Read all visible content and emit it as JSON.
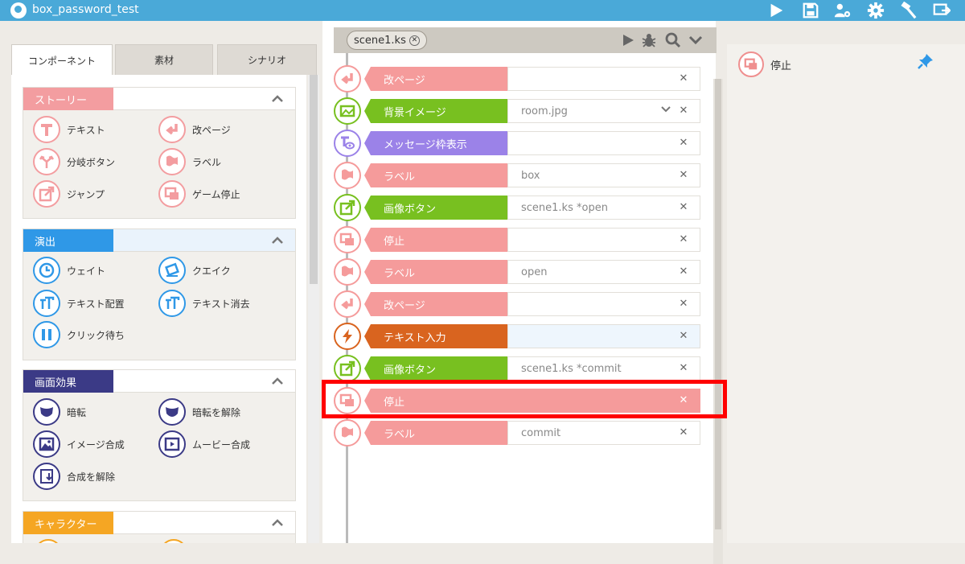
{
  "app": {
    "title": "box_password_test"
  },
  "titlebar_icons": [
    "play-icon",
    "save-icon",
    "users-gear-icon",
    "gear-icon",
    "hammer-icon",
    "export-icon"
  ],
  "tabs": [
    {
      "label": "コンポーネント",
      "active": true
    },
    {
      "label": "素材",
      "active": false
    },
    {
      "label": "シナリオ",
      "active": false
    }
  ],
  "sections": [
    {
      "title": "ストーリー",
      "color": "#f39da0",
      "items": [
        {
          "label": "テキスト",
          "icon": "text-t-icon"
        },
        {
          "label": "改ページ",
          "icon": "page-break-icon"
        },
        {
          "label": "分岐ボタン",
          "icon": "branch-icon"
        },
        {
          "label": "ラベル",
          "icon": "flag-icon"
        },
        {
          "label": "ジャンプ",
          "icon": "jump-icon"
        },
        {
          "label": "ゲーム停止",
          "icon": "stop-window-icon"
        }
      ]
    },
    {
      "title": "演出",
      "color": "#2f98e7",
      "items": [
        {
          "label": "ウェイト",
          "icon": "clock-icon"
        },
        {
          "label": "クエイク",
          "icon": "quake-icon"
        },
        {
          "label": "テキスト配置",
          "icon": "text-place-icon"
        },
        {
          "label": "テキスト消去",
          "icon": "text-erase-icon"
        },
        {
          "label": "クリック待ち",
          "icon": "click-wait-icon"
        }
      ]
    },
    {
      "title": "画面効果",
      "color": "#3b3a86",
      "items": [
        {
          "label": "暗転",
          "icon": "fade-dark-icon"
        },
        {
          "label": "暗転を解除",
          "icon": "fade-release-icon"
        },
        {
          "label": "イメージ合成",
          "icon": "image-compose-icon"
        },
        {
          "label": "ムービー合成",
          "icon": "movie-compose-icon"
        },
        {
          "label": "合成を解除",
          "icon": "compose-release-icon"
        }
      ]
    },
    {
      "title": "キャラクター",
      "color": "#f5a623",
      "items": []
    }
  ],
  "editor": {
    "file_tab": "scene1.ks",
    "rows": [
      {
        "label": "改ページ",
        "value": "",
        "color": "#f59b9b",
        "icon": "page-break-icon",
        "has_dropdown": false
      },
      {
        "label": "背景イメージ",
        "value": "room.jpg",
        "color": "#78c020",
        "icon": "background-image-icon",
        "has_dropdown": true
      },
      {
        "label": "メッセージ枠表示",
        "value": "",
        "color": "#9b82e8",
        "icon": "message-window-icon",
        "has_dropdown": false
      },
      {
        "label": "ラベル",
        "value": "box",
        "color": "#f59b9b",
        "icon": "flag-icon",
        "has_dropdown": false
      },
      {
        "label": "画像ボタン",
        "value": "scene1.ks *open",
        "color": "#78c020",
        "icon": "image-button-icon",
        "has_dropdown": false
      },
      {
        "label": "停止",
        "value": "",
        "color": "#f59b9b",
        "icon": "stop-window-icon",
        "has_dropdown": false
      },
      {
        "label": "ラベル",
        "value": "open",
        "color": "#f59b9b",
        "icon": "flag-icon",
        "has_dropdown": false
      },
      {
        "label": "改ページ",
        "value": "",
        "color": "#f59b9b",
        "icon": "page-break-icon",
        "has_dropdown": false
      },
      {
        "label": "テキスト入力",
        "value": "",
        "color": "#d9641f",
        "icon": "lightning-icon",
        "has_dropdown": false
      },
      {
        "label": "画像ボタン",
        "value": "scene1.ks *commit",
        "color": "#78c020",
        "icon": "image-button-icon",
        "has_dropdown": false
      },
      {
        "label": "停止",
        "value": "",
        "color": "#f59b9b",
        "icon": "stop-window-icon",
        "has_dropdown": false,
        "selected": true
      },
      {
        "label": "ラベル",
        "value": "commit",
        "color": "#f59b9b",
        "icon": "flag-icon",
        "has_dropdown": false
      }
    ]
  },
  "right_panel": {
    "item_label": "停止",
    "item_icon": "stop-window-icon"
  }
}
